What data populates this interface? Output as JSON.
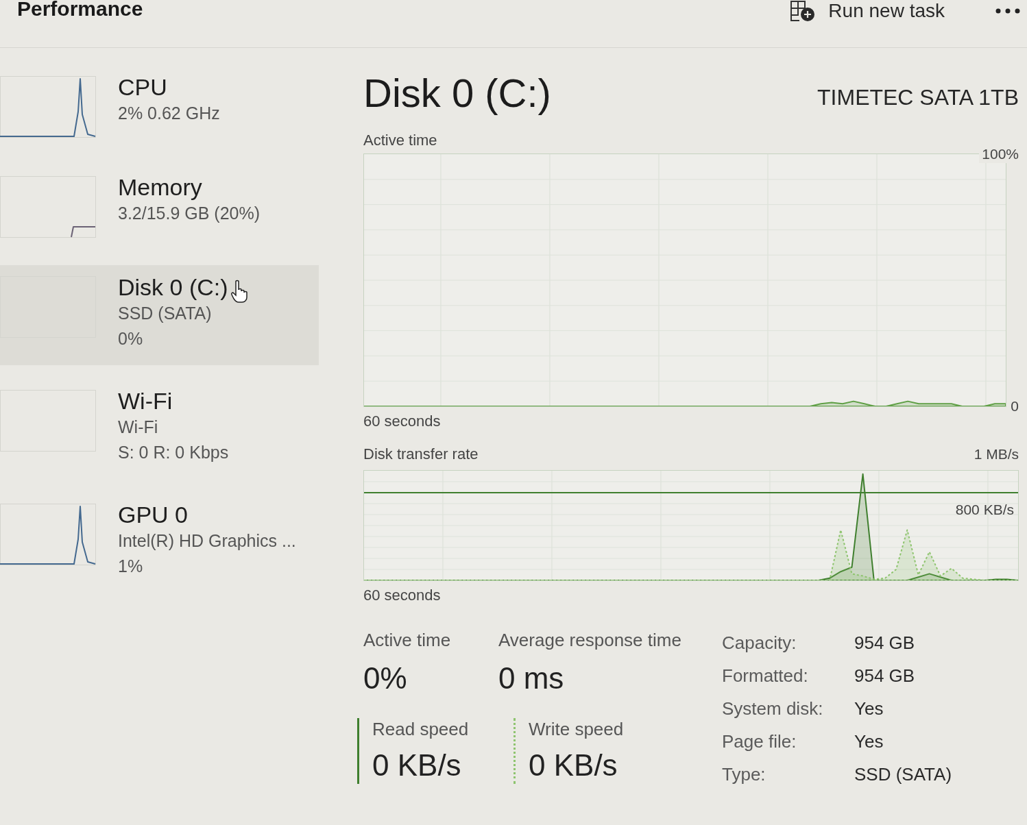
{
  "header": {
    "title": "Performance",
    "actions": [
      {
        "kind": "run",
        "label": "Run new task"
      },
      {
        "kind": "more"
      }
    ]
  },
  "sidebar": {
    "items": [
      {
        "title": "CPU",
        "details": [
          "2% 0.62 GHz"
        ],
        "selected": false,
        "kind": "spike"
      },
      {
        "title": "Memory",
        "details": [
          "3.2/15.9 GB (20%)"
        ],
        "selected": false,
        "kind": "step"
      },
      {
        "title": "Disk 0 (C:)",
        "details": [
          "SSD (SATA)",
          "0%"
        ],
        "selected": true,
        "kind": "blank"
      },
      {
        "title": "Wi-Fi",
        "details": [
          "Wi-Fi",
          "S: 0 R: 0 Kbps"
        ],
        "selected": false,
        "kind": "blank"
      },
      {
        "title": "GPU 0",
        "details": [
          "Intel(R) HD Graphics ...",
          "1%"
        ],
        "selected": false,
        "kind": "spike"
      }
    ]
  },
  "detail": {
    "title": "Disk 0 (C:)",
    "model": "TIMETEC SATA 1TB",
    "active_time_graph": {
      "chart_data": {
        "type": "area",
        "title": "Active time",
        "xlabel": "60 seconds",
        "ylim": [
          0,
          100
        ],
        "yticks": [
          {
            "value": 0,
            "label": "0"
          },
          {
            "value": 100,
            "label": "100%"
          }
        ],
        "grid": true,
        "values": [
          0,
          0,
          0,
          0,
          0,
          0,
          0,
          0,
          0,
          0,
          0,
          0,
          0,
          0,
          0,
          0,
          0,
          0,
          0,
          0,
          0,
          0,
          0,
          0,
          0,
          0,
          0,
          0,
          0,
          0,
          0,
          0,
          0,
          0,
          0,
          0,
          0,
          0,
          0,
          0,
          0,
          0,
          1,
          1.5,
          1,
          2,
          1,
          0,
          0,
          1,
          2,
          1,
          1,
          1,
          1,
          0,
          0,
          0,
          1,
          1
        ]
      }
    },
    "transfer_rate_graph": {
      "title": "Disk transfer rate",
      "max_label": "1 MB/s",
      "scale_label": "800 KB/s",
      "time_span": "60 seconds"
    },
    "stats": [
      {
        "label": "Active time",
        "value": "0%"
      },
      {
        "label": "Average response time",
        "value": "0 ms"
      }
    ],
    "speeds": [
      {
        "label": "Read speed",
        "value": "0 KB/s",
        "dotted": false,
        "color": "#3f7f2e"
      },
      {
        "label": "Write speed",
        "value": "0 KB/s",
        "dotted": true,
        "color": "#8ec46e"
      }
    ],
    "properties": [
      {
        "label": "Capacity:",
        "value": "954 GB"
      },
      {
        "label": "Formatted:",
        "value": "954 GB"
      },
      {
        "label": "System disk:",
        "value": "Yes"
      },
      {
        "label": "Page file:",
        "value": "Yes"
      },
      {
        "label": "Type:",
        "value": "SSD (SATA)"
      }
    ]
  }
}
